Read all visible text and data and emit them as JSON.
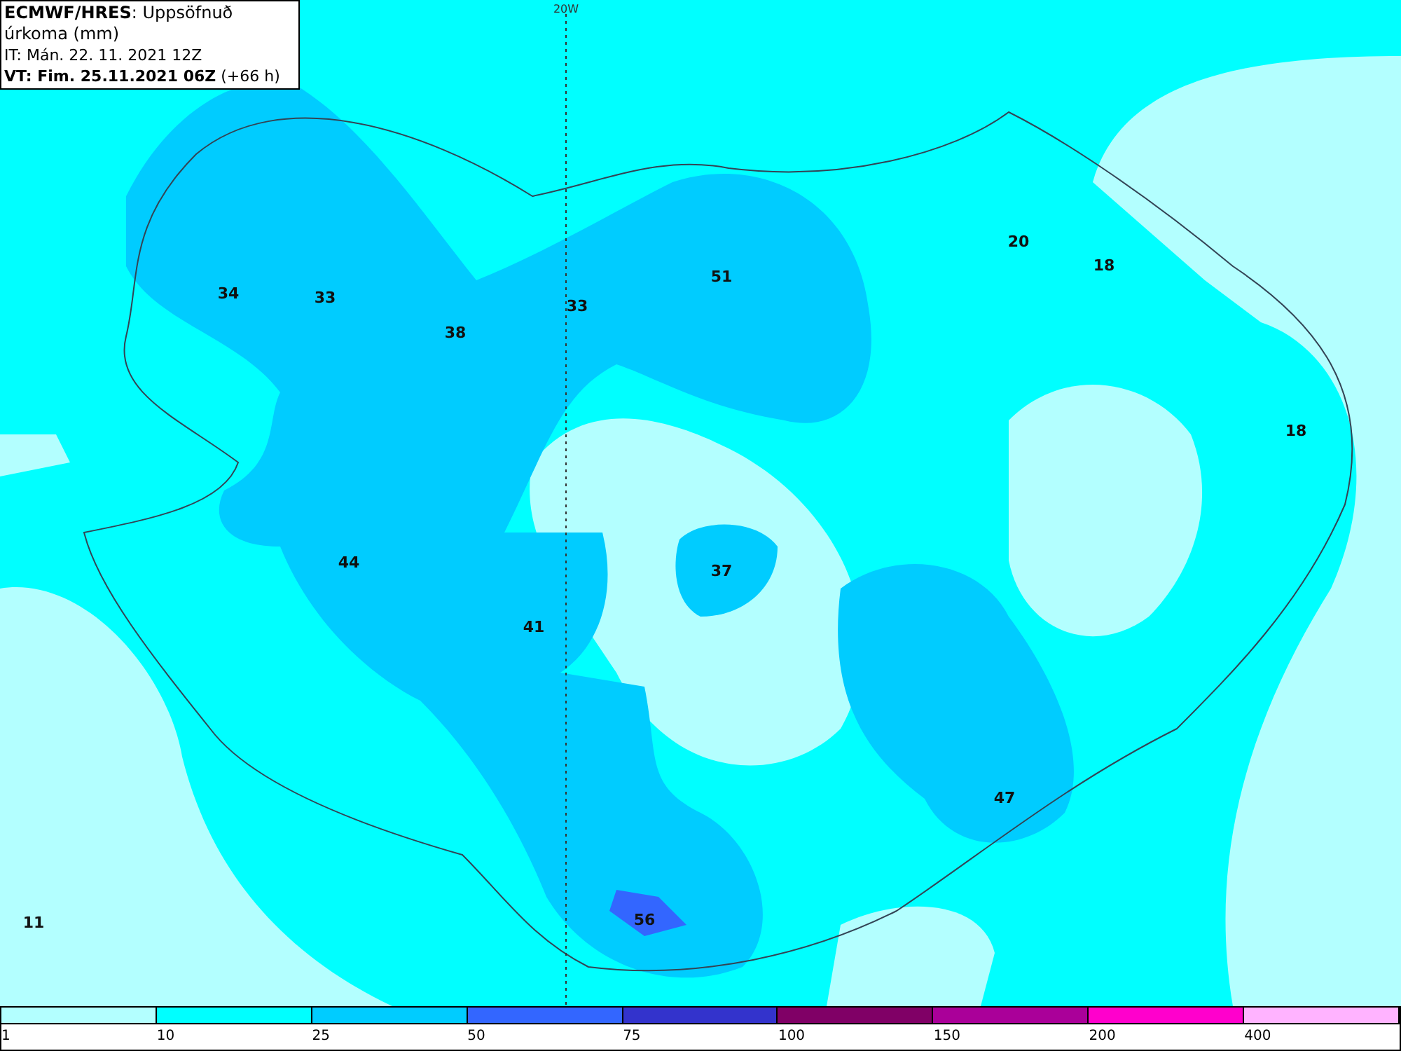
{
  "header": {
    "title": "**ECMWF/HRES**: Uppsöfnuð úrkoma (mm)",
    "issue_time": "IT: Mán. 22. 11. 2021 12Z",
    "valid_time": "**VT: Fim. 25.11.2021 06Z** (+66 h)"
  },
  "map": {
    "meridian_label": "20W",
    "values": [
      "34",
      "33",
      "38",
      "33",
      "51",
      "20",
      "18",
      "18",
      "44",
      "37",
      "41",
      "47",
      "56",
      "11"
    ]
  },
  "legend": [
    {
      "color": "#b3ffff",
      "label": "1"
    },
    {
      "color": "#00ffff",
      "label": "10"
    },
    {
      "color": "#00ccff",
      "label": "25"
    },
    {
      "color": "#3366ff",
      "label": "50"
    },
    {
      "color": "#3333cc",
      "label": "75"
    },
    {
      "color": "#800066",
      "label": "100"
    },
    {
      "color": "#aa0099",
      "label": "150"
    },
    {
      "color": "#ff00cc",
      "label": "200"
    },
    {
      "color": "#ffb3ff",
      "label": "400"
    }
  ]
}
